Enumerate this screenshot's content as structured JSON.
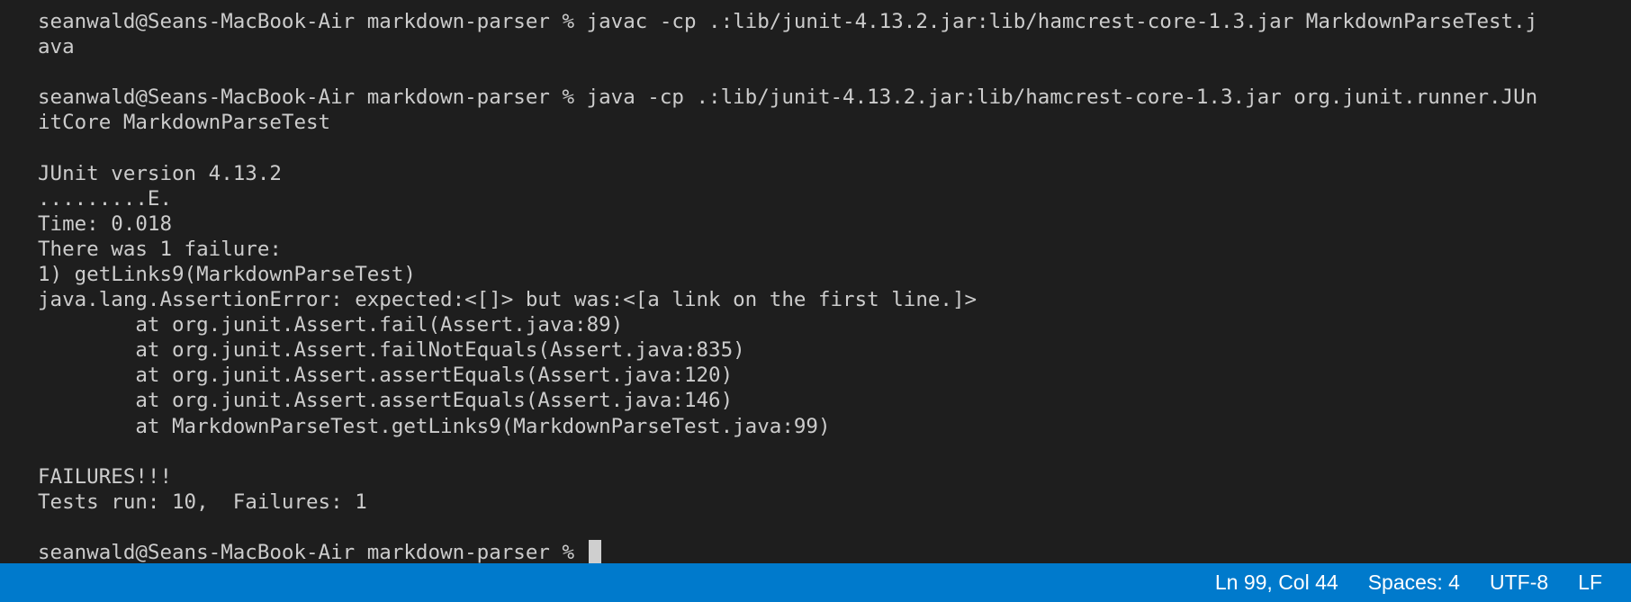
{
  "terminal": {
    "lines": [
      "seanwald@Seans-MacBook-Air markdown-parser % javac -cp .:lib/junit-4.13.2.jar:lib/hamcrest-core-1.3.jar MarkdownParseTest.j",
      "ava",
      "",
      "seanwald@Seans-MacBook-Air markdown-parser % java -cp .:lib/junit-4.13.2.jar:lib/hamcrest-core-1.3.jar org.junit.runner.JUn",
      "itCore MarkdownParseTest",
      "",
      "JUnit version 4.13.2",
      ".........E.",
      "Time: 0.018",
      "There was 1 failure:",
      "1) getLinks9(MarkdownParseTest)",
      "java.lang.AssertionError: expected:<[]> but was:<[a link on the first line.]>",
      "        at org.junit.Assert.fail(Assert.java:89)",
      "        at org.junit.Assert.failNotEquals(Assert.java:835)",
      "        at org.junit.Assert.assertEquals(Assert.java:120)",
      "        at org.junit.Assert.assertEquals(Assert.java:146)",
      "        at MarkdownParseTest.getLinks9(MarkdownParseTest.java:99)",
      "",
      "FAILURES!!!",
      "Tests run: 10,  Failures: 1"
    ],
    "prompt": "seanwald@Seans-MacBook-Air markdown-parser % "
  },
  "status_bar": {
    "position": "Ln 99, Col 44",
    "spaces": "Spaces: 4",
    "encoding": "UTF-8",
    "eol": "LF"
  },
  "colors": {
    "terminal_bg": "#1e1e1e",
    "terminal_text": "#cccccc",
    "status_bar_bg": "#007acc",
    "status_bar_text": "#ffffff"
  }
}
